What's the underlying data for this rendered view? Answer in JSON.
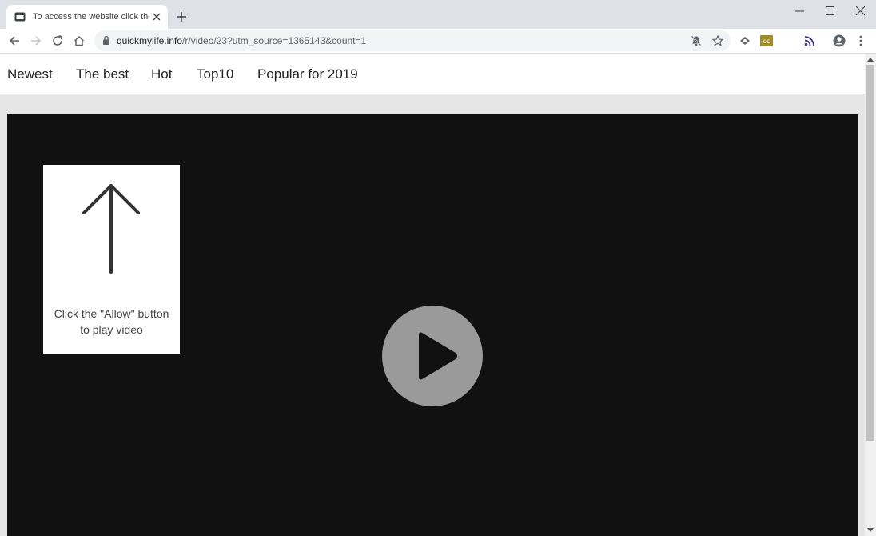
{
  "browser": {
    "tab": {
      "title": "To access the website click the \"Allow\"",
      "favicon": "video-player-icon"
    },
    "url": {
      "host": "quickmylife.info",
      "path": "/r/video/23?utm_source=1365143&count=1"
    },
    "window_controls": [
      "minimize-icon",
      "maximize-icon",
      "close-icon"
    ]
  },
  "nav": {
    "items": [
      {
        "label": "Newest"
      },
      {
        "label": "The best"
      },
      {
        "label": "Hot"
      },
      {
        "label": "Top10"
      },
      {
        "label": "Popular for 2019"
      }
    ]
  },
  "overlay": {
    "line1": "Click the \"Allow\" button",
    "line2": "to play video"
  },
  "colors": {
    "video_bg": "#111111",
    "play_button": "#9a9a9a",
    "tab_strip": "#dee1e6"
  }
}
